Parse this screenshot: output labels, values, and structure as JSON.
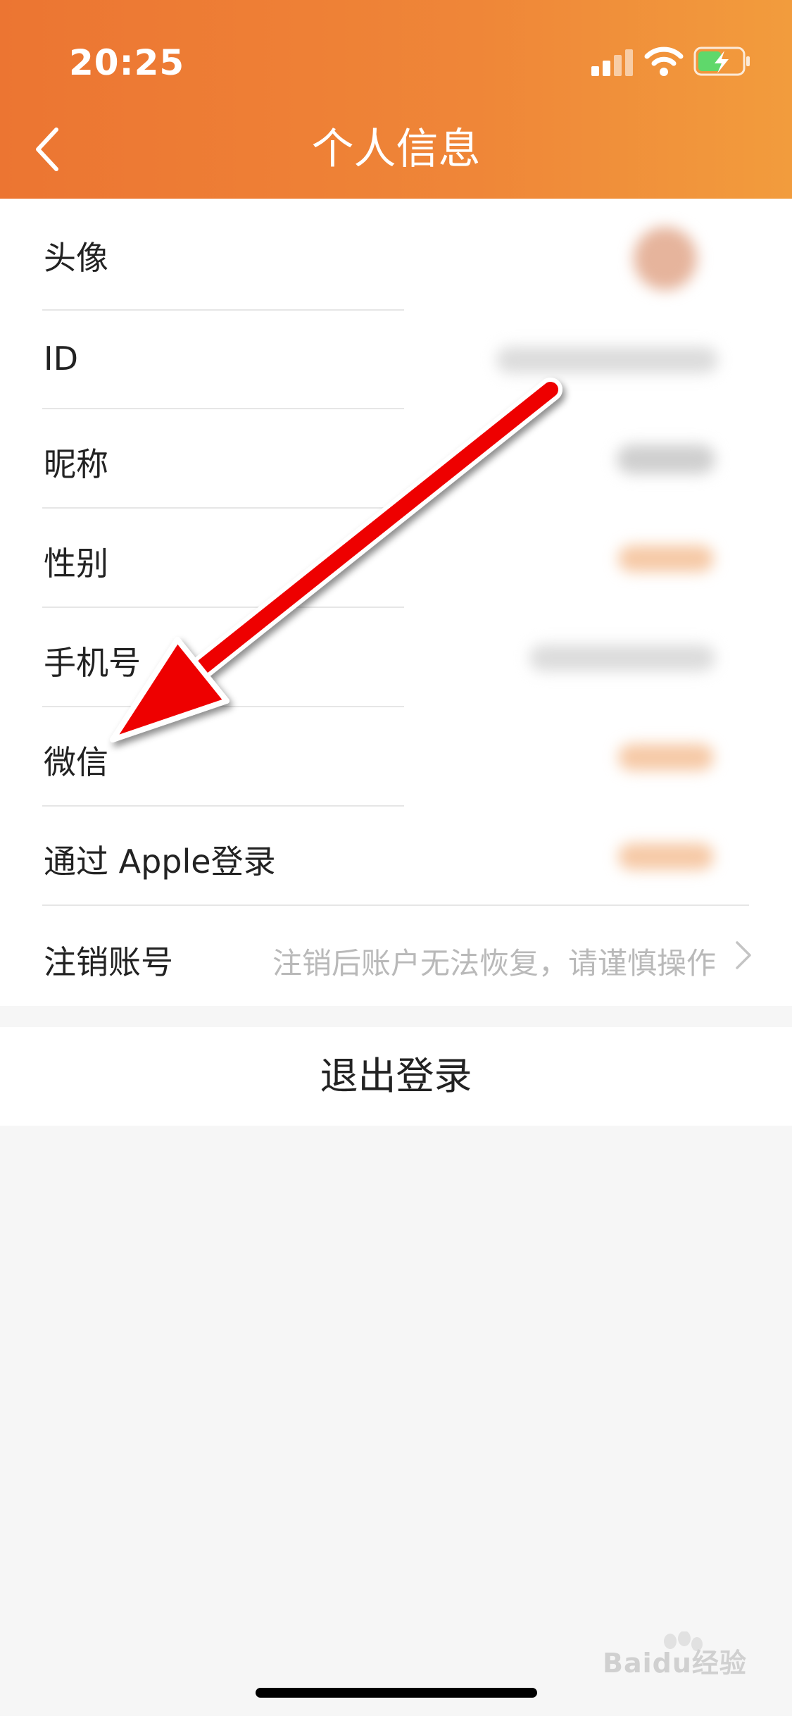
{
  "status_bar": {
    "time": "20:25"
  },
  "nav": {
    "title": "个人信息",
    "back_icon": "chevron-left-icon"
  },
  "rows": [
    {
      "label": "头像"
    },
    {
      "label": "ID"
    },
    {
      "label": "昵称"
    },
    {
      "label": "性别"
    },
    {
      "label": "手机号"
    },
    {
      "label": "微信"
    },
    {
      "label": "通过 Apple登录"
    },
    {
      "label": "注销账号",
      "hint": "注销后账户无法恢复，请谨慎操作"
    }
  ],
  "logout": {
    "label": "退出登录"
  },
  "watermark": {
    "text": "Baidu经验"
  },
  "colors": {
    "header_start": "#ec7532",
    "header_end": "#f29c3d",
    "annotation_arrow": "#ee0000"
  }
}
